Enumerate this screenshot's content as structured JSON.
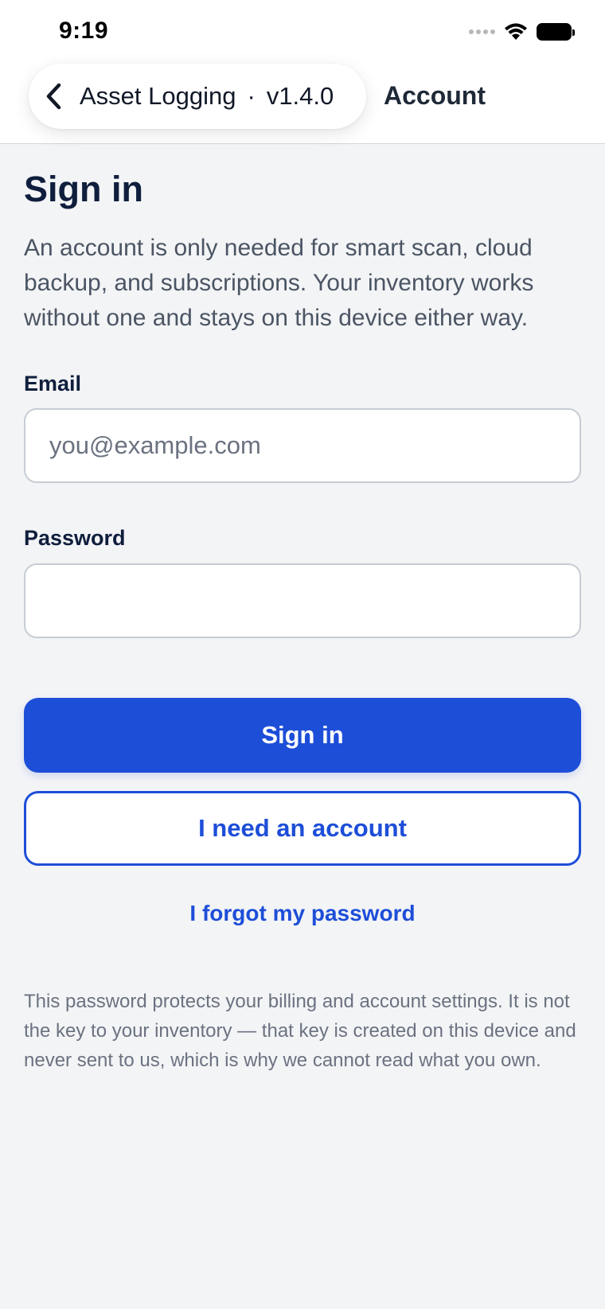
{
  "status_bar": {
    "time": "9:19"
  },
  "nav": {
    "back_app_name": "Asset Logging",
    "separator": "·",
    "version": "v1.4.0",
    "title": "Account"
  },
  "main": {
    "heading": "Sign in",
    "intro": "An account is only needed for smart scan, cloud backup, and subscriptions. Your inventory works without one and stays on this device either way.",
    "email": {
      "label": "Email",
      "placeholder": "you@example.com",
      "value": ""
    },
    "password": {
      "label": "Password",
      "placeholder": "",
      "value": ""
    },
    "sign_in_button": "Sign in",
    "create_account_button": "I need an account",
    "forgot_password_link": "I forgot my password",
    "footnote": "This password protects your billing and account settings. It is not the key to your inventory — that key is created on this device and never sent to us, which is why we cannot read what you own."
  },
  "colors": {
    "accent": "#1d4ed8",
    "background": "#f3f4f6",
    "heading": "#0f1e3c"
  },
  "icons": {
    "back": "chevron-left-icon",
    "cellular": "cellular-signal-icon",
    "wifi": "wifi-icon",
    "battery": "battery-icon"
  }
}
